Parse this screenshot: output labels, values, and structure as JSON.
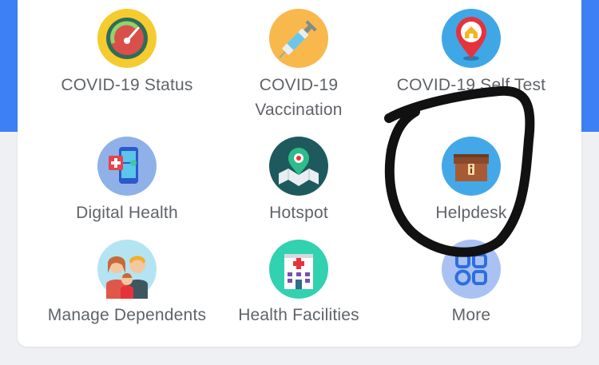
{
  "colors": {
    "accent_blue": "#3d7ff5",
    "label_gray": "#5f6368",
    "card_bg": "#ffffff",
    "page_bg": "#eef0f3",
    "annotation_ink": "#111111"
  },
  "menu": {
    "items": [
      {
        "label": "COVID-19 Status",
        "icon": "speedometer-icon"
      },
      {
        "label": "COVID-19\nVaccination",
        "icon": "syringe-icon"
      },
      {
        "label": "COVID-19 Self Test",
        "icon": "home-location-pin-icon"
      },
      {
        "label": "Digital Health",
        "icon": "phone-medical-icon"
      },
      {
        "label": "Hotspot",
        "icon": "map-pin-icon"
      },
      {
        "label": "Helpdesk",
        "icon": "info-box-icon"
      },
      {
        "label": "Manage Dependents",
        "icon": "family-icon"
      },
      {
        "label": "Health Facilities",
        "icon": "hospital-icon"
      },
      {
        "label": "More",
        "icon": "grid-apps-icon"
      }
    ]
  }
}
